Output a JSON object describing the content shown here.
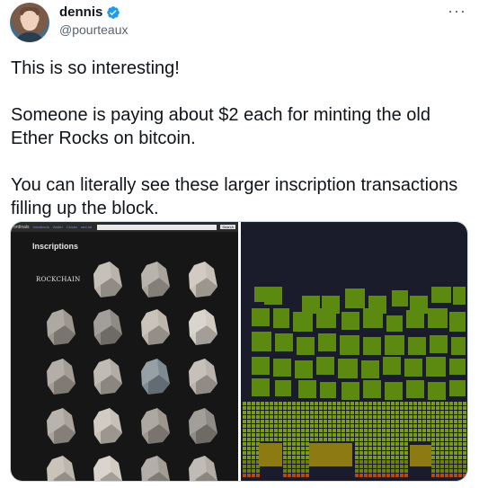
{
  "author": {
    "display_name": "dennis",
    "handle": "@pourteaux",
    "verified_icon": "verified-badge-icon",
    "more_icon": "more-horizontal-icon"
  },
  "tweet": {
    "paragraphs": [
      "This is so interesting!",
      "Someone is paying about $2 each for minting the old Ether Rocks on bitcoin.",
      "You can literally see these larger inscription transactions filling up the block."
    ]
  },
  "media": {
    "left": {
      "nav": {
        "brand": "ordinals",
        "links": [
          "Handbook",
          "Wallet",
          "Clocks",
          "rare.txt"
        ],
        "search_button": "Search"
      },
      "page_title": "Inscriptions",
      "first_label": "ROCKCHAIN",
      "rock_icon": "ether-rock-icon"
    },
    "right": {
      "description": "mempool block visualization",
      "colors": {
        "background": "#1a1c2b",
        "large_tx": "#5c8a10",
        "small_tx": "#7a9a1e",
        "highlight_tx": "#8d7a12",
        "low_fee": "#b24a14"
      }
    }
  },
  "colors": {
    "text": "#0f1419",
    "secondary": "#536471",
    "verified": "#1d9bf0",
    "border": "#cfd9de"
  }
}
